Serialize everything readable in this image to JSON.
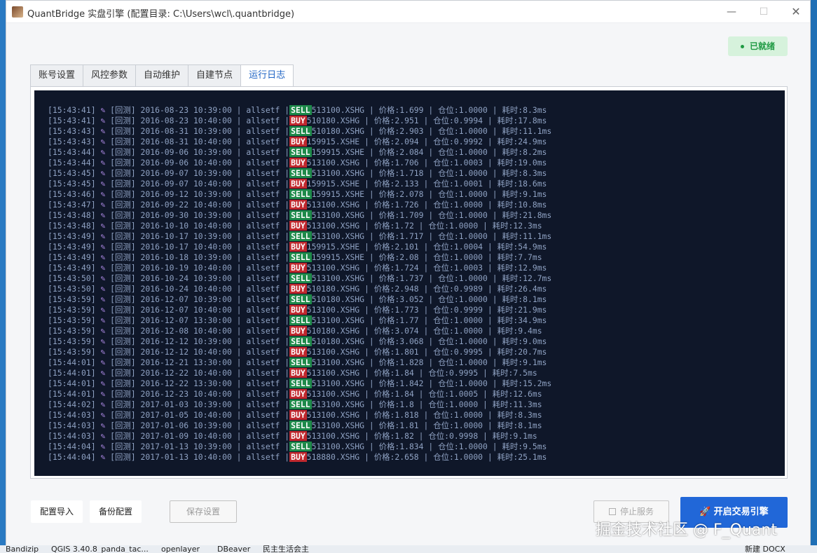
{
  "window": {
    "title": "QuantBridge 实盘引擎 (配置目录: C:\\Users\\wcl\\.quantbridge)",
    "min_glyph": "—",
    "max_glyph": "☐",
    "close_glyph": "✕"
  },
  "status": {
    "label": "已就绪",
    "color": "#1f9a43"
  },
  "tabs": [
    {
      "label": "账号设置",
      "active": false
    },
    {
      "label": "风控参数",
      "active": false
    },
    {
      "label": "自动维护",
      "active": false
    },
    {
      "label": "自建节点",
      "active": false
    },
    {
      "label": "运行日志",
      "active": true
    }
  ],
  "log": {
    "icon": "pencil-icon",
    "rows": [
      {
        "time": "[15:43:41]",
        "tag": "[回测]",
        "datetime": "2016-08-23 10:39:00",
        "strategy": "allsetf",
        "side": "SELL",
        "code": "513100.XSHG",
        "price": "1.699",
        "position": "1.0000",
        "elapsed": "8.3ms"
      },
      {
        "time": "[15:43:41]",
        "tag": "[回测]",
        "datetime": "2016-08-23 10:40:00",
        "strategy": "allsetf",
        "side": "BUY",
        "code": "510180.XSHG",
        "price": "2.951",
        "position": "0.9994",
        "elapsed": "17.8ms"
      },
      {
        "time": "[15:43:43]",
        "tag": "[回测]",
        "datetime": "2016-08-31 10:39:00",
        "strategy": "allsetf",
        "side": "SELL",
        "code": "510180.XSHG",
        "price": "2.903",
        "position": "1.0000",
        "elapsed": "11.1ms"
      },
      {
        "time": "[15:43:43]",
        "tag": "[回测]",
        "datetime": "2016-08-31 10:40:00",
        "strategy": "allsetf",
        "side": "BUY",
        "code": "159915.XSHE",
        "price": "2.094",
        "position": "0.9992",
        "elapsed": "24.9ms"
      },
      {
        "time": "[15:43:44]",
        "tag": "[回测]",
        "datetime": "2016-09-06 10:39:00",
        "strategy": "allsetf",
        "side": "SELL",
        "code": "159915.XSHE",
        "price": "2.084",
        "position": "1.0000",
        "elapsed": "8.2ms"
      },
      {
        "time": "[15:43:44]",
        "tag": "[回测]",
        "datetime": "2016-09-06 10:40:00",
        "strategy": "allsetf",
        "side": "BUY",
        "code": "513100.XSHG",
        "price": "1.706",
        "position": "1.0003",
        "elapsed": "19.0ms"
      },
      {
        "time": "[15:43:45]",
        "tag": "[回测]",
        "datetime": "2016-09-07 10:39:00",
        "strategy": "allsetf",
        "side": "SELL",
        "code": "513100.XSHG",
        "price": "1.718",
        "position": "1.0000",
        "elapsed": "8.3ms"
      },
      {
        "time": "[15:43:45]",
        "tag": "[回测]",
        "datetime": "2016-09-07 10:40:00",
        "strategy": "allsetf",
        "side": "BUY",
        "code": "159915.XSHE",
        "price": "2.133",
        "position": "1.0001",
        "elapsed": "18.6ms"
      },
      {
        "time": "[15:43:46]",
        "tag": "[回测]",
        "datetime": "2016-09-12 10:39:00",
        "strategy": "allsetf",
        "side": "SELL",
        "code": "159915.XSHE",
        "price": "2.078",
        "position": "1.0000",
        "elapsed": "9.1ms"
      },
      {
        "time": "[15:43:47]",
        "tag": "[回测]",
        "datetime": "2016-09-22 10:40:00",
        "strategy": "allsetf",
        "side": "BUY",
        "code": "513100.XSHG",
        "price": "1.726",
        "position": "1.0000",
        "elapsed": "10.8ms"
      },
      {
        "time": "[15:43:48]",
        "tag": "[回测]",
        "datetime": "2016-09-30 10:39:00",
        "strategy": "allsetf",
        "side": "SELL",
        "code": "513100.XSHG",
        "price": "1.709",
        "position": "1.0000",
        "elapsed": "21.8ms"
      },
      {
        "time": "[15:43:48]",
        "tag": "[回测]",
        "datetime": "2016-10-10 10:40:00",
        "strategy": "allsetf",
        "side": "BUY",
        "code": "513100.XSHG",
        "price": "1.72",
        "position": "1.0000",
        "elapsed": "12.3ms"
      },
      {
        "time": "[15:43:49]",
        "tag": "[回测]",
        "datetime": "2016-10-17 10:39:00",
        "strategy": "allsetf",
        "side": "SELL",
        "code": "513100.XSHG",
        "price": "1.717",
        "position": "1.0000",
        "elapsed": "11.1ms"
      },
      {
        "time": "[15:43:49]",
        "tag": "[回测]",
        "datetime": "2016-10-17 10:40:00",
        "strategy": "allsetf",
        "side": "BUY",
        "code": "159915.XSHE",
        "price": "2.101",
        "position": "1.0004",
        "elapsed": "54.9ms"
      },
      {
        "time": "[15:43:49]",
        "tag": "[回测]",
        "datetime": "2016-10-18 10:39:00",
        "strategy": "allsetf",
        "side": "SELL",
        "code": "159915.XSHE",
        "price": "2.08",
        "position": "1.0000",
        "elapsed": "7.7ms"
      },
      {
        "time": "[15:43:49]",
        "tag": "[回测]",
        "datetime": "2016-10-19 10:40:00",
        "strategy": "allsetf",
        "side": "BUY",
        "code": "513100.XSHG",
        "price": "1.724",
        "position": "1.0003",
        "elapsed": "12.9ms"
      },
      {
        "time": "[15:43:50]",
        "tag": "[回测]",
        "datetime": "2016-10-24 10:39:00",
        "strategy": "allsetf",
        "side": "SELL",
        "code": "513100.XSHG",
        "price": "1.737",
        "position": "1.0000",
        "elapsed": "12.7ms"
      },
      {
        "time": "[15:43:50]",
        "tag": "[回测]",
        "datetime": "2016-10-24 10:40:00",
        "strategy": "allsetf",
        "side": "BUY",
        "code": "510180.XSHG",
        "price": "2.948",
        "position": "0.9989",
        "elapsed": "26.4ms"
      },
      {
        "time": "[15:43:59]",
        "tag": "[回测]",
        "datetime": "2016-12-07 10:39:00",
        "strategy": "allsetf",
        "side": "SELL",
        "code": "510180.XSHG",
        "price": "3.052",
        "position": "1.0000",
        "elapsed": "8.1ms"
      },
      {
        "time": "[15:43:59]",
        "tag": "[回测]",
        "datetime": "2016-12-07 10:40:00",
        "strategy": "allsetf",
        "side": "BUY",
        "code": "513100.XSHG",
        "price": "1.773",
        "position": "0.9999",
        "elapsed": "21.9ms"
      },
      {
        "time": "[15:43:59]",
        "tag": "[回测]",
        "datetime": "2016-12-07 13:30:00",
        "strategy": "allsetf",
        "side": "SELL",
        "code": "513100.XSHG",
        "price": "1.77",
        "position": "1.0000",
        "elapsed": "34.9ms"
      },
      {
        "time": "[15:43:59]",
        "tag": "[回测]",
        "datetime": "2016-12-08 10:40:00",
        "strategy": "allsetf",
        "side": "BUY",
        "code": "510180.XSHG",
        "price": "3.074",
        "position": "1.0000",
        "elapsed": "9.4ms"
      },
      {
        "time": "[15:43:59]",
        "tag": "[回测]",
        "datetime": "2016-12-12 10:39:00",
        "strategy": "allsetf",
        "side": "SELL",
        "code": "510180.XSHG",
        "price": "3.068",
        "position": "1.0000",
        "elapsed": "9.0ms"
      },
      {
        "time": "[15:43:59]",
        "tag": "[回测]",
        "datetime": "2016-12-12 10:40:00",
        "strategy": "allsetf",
        "side": "BUY",
        "code": "513100.XSHG",
        "price": "1.801",
        "position": "0.9995",
        "elapsed": "20.7ms"
      },
      {
        "time": "[15:44:01]",
        "tag": "[回测]",
        "datetime": "2016-12-21 13:30:00",
        "strategy": "allsetf",
        "side": "SELL",
        "code": "513100.XSHG",
        "price": "1.828",
        "position": "1.0000",
        "elapsed": "9.1ms"
      },
      {
        "time": "[15:44:01]",
        "tag": "[回测]",
        "datetime": "2016-12-22 10:40:00",
        "strategy": "allsetf",
        "side": "BUY",
        "code": "513100.XSHG",
        "price": "1.84",
        "position": "0.9995",
        "elapsed": "7.5ms"
      },
      {
        "time": "[15:44:01]",
        "tag": "[回测]",
        "datetime": "2016-12-22 13:30:00",
        "strategy": "allsetf",
        "side": "SELL",
        "code": "513100.XSHG",
        "price": "1.842",
        "position": "1.0000",
        "elapsed": "15.2ms"
      },
      {
        "time": "[15:44:01]",
        "tag": "[回测]",
        "datetime": "2016-12-23 10:40:00",
        "strategy": "allsetf",
        "side": "BUY",
        "code": "513100.XSHG",
        "price": "1.84",
        "position": "1.0005",
        "elapsed": "12.6ms"
      },
      {
        "time": "[15:44:02]",
        "tag": "[回测]",
        "datetime": "2017-01-03 10:39:00",
        "strategy": "allsetf",
        "side": "SELL",
        "code": "513100.XSHG",
        "price": "1.8",
        "position": "1.0000",
        "elapsed": "11.3ms"
      },
      {
        "time": "[15:44:03]",
        "tag": "[回测]",
        "datetime": "2017-01-05 10:40:00",
        "strategy": "allsetf",
        "side": "BUY",
        "code": "513100.XSHG",
        "price": "1.818",
        "position": "1.0000",
        "elapsed": "8.3ms"
      },
      {
        "time": "[15:44:03]",
        "tag": "[回测]",
        "datetime": "2017-01-06 10:39:00",
        "strategy": "allsetf",
        "side": "SELL",
        "code": "513100.XSHG",
        "price": "1.81",
        "position": "1.0000",
        "elapsed": "8.1ms"
      },
      {
        "time": "[15:44:03]",
        "tag": "[回测]",
        "datetime": "2017-01-09 10:40:00",
        "strategy": "allsetf",
        "side": "BUY",
        "code": "513100.XSHG",
        "price": "1.82",
        "position": "0.9998",
        "elapsed": "9.1ms"
      },
      {
        "time": "[15:44:04]",
        "tag": "[回测]",
        "datetime": "2017-01-13 10:39:00",
        "strategy": "allsetf",
        "side": "SELL",
        "code": "513100.XSHG",
        "price": "1.834",
        "position": "1.0000",
        "elapsed": "9.5ms"
      },
      {
        "time": "[15:44:04]",
        "tag": "[回测]",
        "datetime": "2017-01-13 10:40:00",
        "strategy": "allsetf",
        "side": "BUY",
        "code": "518880.XSHG",
        "price": "2.658",
        "position": "1.0000",
        "elapsed": "25.1ms"
      }
    ],
    "price_label": "价格:",
    "position_label": "仓位:",
    "elapsed_label": "耗时:",
    "sell_color": "#1e8a4a",
    "buy_color": "#c0282e"
  },
  "footer": {
    "import_label": "配置导入",
    "backup_label": "备份配置",
    "save_label": "保存设置",
    "stop_label": "停止服务",
    "start_label": "开启交易引擎",
    "start_icon": "rocket-icon",
    "accent": "#2167d8"
  },
  "watermark": "掘金技术社区 @ F_Quant",
  "desktop": {
    "taskbar_items": [
      "Bandizip",
      "QGIS 3.40.8_panda_tac...",
      "openlayer",
      "DBeaver",
      "民主生活会主",
      "新建 DOCX"
    ]
  }
}
